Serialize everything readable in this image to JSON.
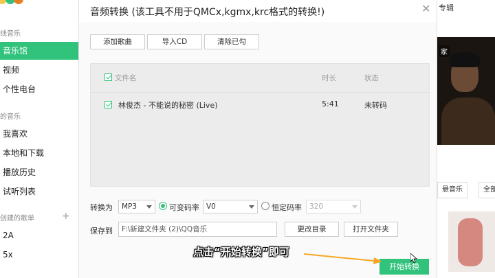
{
  "colors": {
    "accent": "#31c27c",
    "annotation_arrow": "#f5a623"
  },
  "sidebar": {
    "section_online_partial": "线音乐",
    "items_online": [
      {
        "label": "音乐馆",
        "active": true
      },
      {
        "label": "视频",
        "active": false
      },
      {
        "label": "个性电台",
        "active": false
      }
    ],
    "section_my_partial": "的音乐",
    "items_my": [
      {
        "label": "我喜欢"
      },
      {
        "label": "本地和下载"
      },
      {
        "label": "播放历史"
      },
      {
        "label": "试听列表"
      }
    ],
    "section_created_partial": "创建的歌单",
    "plus_icon": "plus-icon",
    "playlists": [
      {
        "label": "2A"
      },
      {
        "label": "5x"
      }
    ]
  },
  "background_right": {
    "tab_partial": "专辑",
    "banner_tag_partial": "家",
    "btn_music_partial": "悬音乐",
    "btn_all_partial": "全部"
  },
  "dialog": {
    "title": "音频转换 (该工具不用于QMCx,kgmx,krc格式的转换!)",
    "close_icon": "close-icon",
    "buttons": {
      "add_song": "添加歌曲",
      "import_cd": "导入CD",
      "clear_checked": "清除已勾"
    },
    "list": {
      "headers": {
        "file_name": "文件名",
        "duration": "时长",
        "status": "状态"
      },
      "rows": [
        {
          "checked": true,
          "name": "林俊杰 - 不能说的秘密 (Live)",
          "duration": "5:41",
          "status": "未转码"
        }
      ]
    },
    "convert": {
      "label": "转换为",
      "format": "MP3",
      "vbr_label": "可变码率",
      "vbr_selected": true,
      "vbr_value": "V0",
      "cbr_label": "恒定码率",
      "cbr_value": "320"
    },
    "save": {
      "label": "保存到",
      "path": "F:\\新建文件夹 (2)\\QQ音乐",
      "change_dir": "更改目录",
      "open_folder": "打开文件夹"
    },
    "start_button": "开始转换"
  },
  "caption": "点击“开始转换”即可"
}
